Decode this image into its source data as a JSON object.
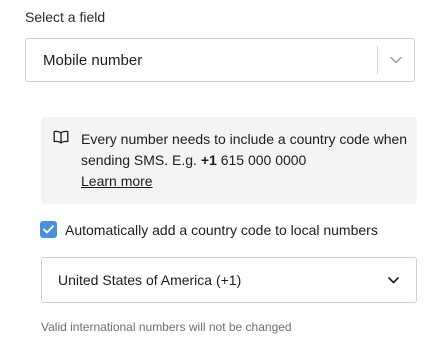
{
  "field_label": "Select a field",
  "field_select": {
    "value": "Mobile number",
    "icon": "chevron-down-icon"
  },
  "info": {
    "icon": "book-icon",
    "text_part1": "Every number needs to include a country code when sending SMS. E.g. ",
    "example_bold": "+1",
    "text_part2": " 615 000 0000",
    "link": "Learn more"
  },
  "auto_country_code": {
    "checked": true,
    "label": "Automatically add a country code to local numbers"
  },
  "country_select": {
    "value": "United States of America (+1)",
    "icon": "chevron-down-icon"
  },
  "help_text": "Valid international numbers will not be changed",
  "colors": {
    "checkbox_accent": "#4a90d9",
    "info_bg": "#f3f4f6",
    "border": "#c9ced6"
  }
}
